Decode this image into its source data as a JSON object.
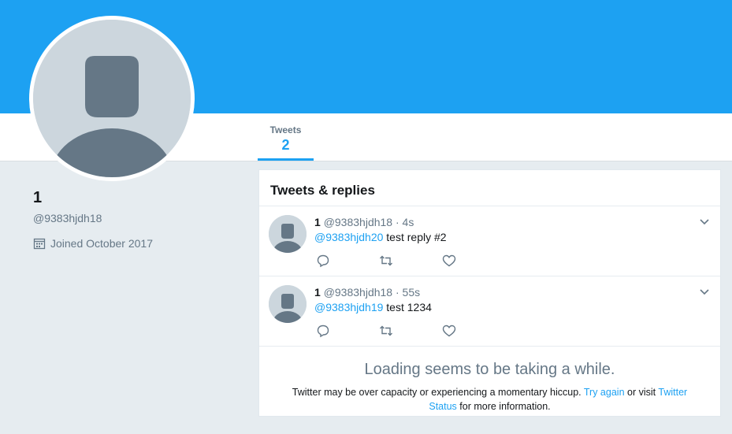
{
  "profile": {
    "name": "1",
    "handle": "@9383hjdh18",
    "joined": "Joined October 2017"
  },
  "nav": {
    "tweets_label": "Tweets",
    "tweets_count": "2"
  },
  "timeline": {
    "title": "Tweets & replies",
    "tweets": [
      {
        "name": "1",
        "handle": "@9383hjdh18",
        "sep": "·",
        "time": "4s",
        "mention": "@9383hjdh20",
        "text": "test reply #2"
      },
      {
        "name": "1",
        "handle": "@9383hjdh18",
        "sep": "·",
        "time": "55s",
        "mention": "@9383hjdh19",
        "text": "test 1234"
      }
    ]
  },
  "loading": {
    "title": "Loading seems to be taking a while.",
    "msg_part1": "Twitter may be over capacity or experiencing a momentary hiccup.",
    "try_again": "Try again",
    "msg_part2": "or visit",
    "status_link": "Twitter Status",
    "msg_part3": "for more information."
  },
  "colors": {
    "brand": "#1da1f2",
    "background": "#e6ecf0",
    "avatar_placeholder": "#ccd6dd",
    "avatar_silhouette": "#657786"
  },
  "icons": {
    "calendar": "calendar-icon",
    "reply": "reply-icon",
    "retweet": "retweet-icon",
    "like": "heart-icon",
    "caret": "chevron-down-icon"
  }
}
